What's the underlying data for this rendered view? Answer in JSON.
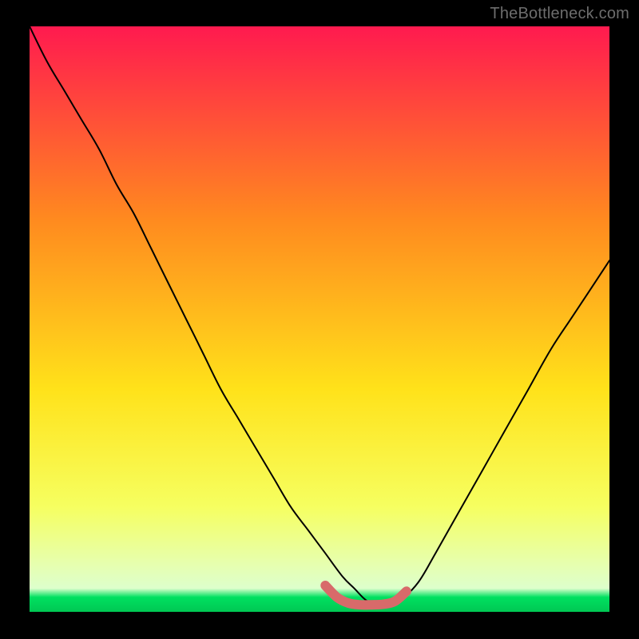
{
  "watermark": "TheBottleneck.com",
  "colors": {
    "bg": "#000000",
    "gradient_top": "#ff1a4f",
    "gradient_upper_mid": "#ff8a1f",
    "gradient_mid": "#ffe21a",
    "gradient_lower_mid": "#f6ff60",
    "gradient_near_bottom": "#e6ffb0",
    "gradient_fill_bottom": "#ddffcc",
    "gradient_stripe": "#00e060",
    "gradient_bottom": "#00c853",
    "curve": "#000000",
    "marker": "#d86a6a"
  },
  "chart_data": {
    "type": "line",
    "title": "",
    "xlabel": "",
    "ylabel": "",
    "xlim": [
      0,
      100
    ],
    "ylim": [
      0,
      100
    ],
    "series": [
      {
        "name": "bottleneck-curve",
        "x": [
          0,
          3,
          6,
          9,
          12,
          15,
          18,
          21,
          24,
          27,
          30,
          33,
          36,
          39,
          42,
          45,
          48,
          51,
          54,
          56,
          58,
          60,
          62,
          64,
          67,
          70,
          74,
          78,
          82,
          86,
          90,
          94,
          100
        ],
        "y": [
          100,
          94,
          89,
          84,
          79,
          73,
          68,
          62,
          56,
          50,
          44,
          38,
          33,
          28,
          23,
          18,
          14,
          10,
          6,
          4,
          2,
          1,
          1,
          2,
          5,
          10,
          17,
          24,
          31,
          38,
          45,
          51,
          60
        ]
      },
      {
        "name": "optimal-range-marker",
        "x": [
          51,
          53,
          55,
          57,
          59,
          61,
          63,
          65
        ],
        "y": [
          4.5,
          2.5,
          1.5,
          1.2,
          1.2,
          1.3,
          1.8,
          3.5
        ]
      }
    ],
    "annotations": []
  }
}
